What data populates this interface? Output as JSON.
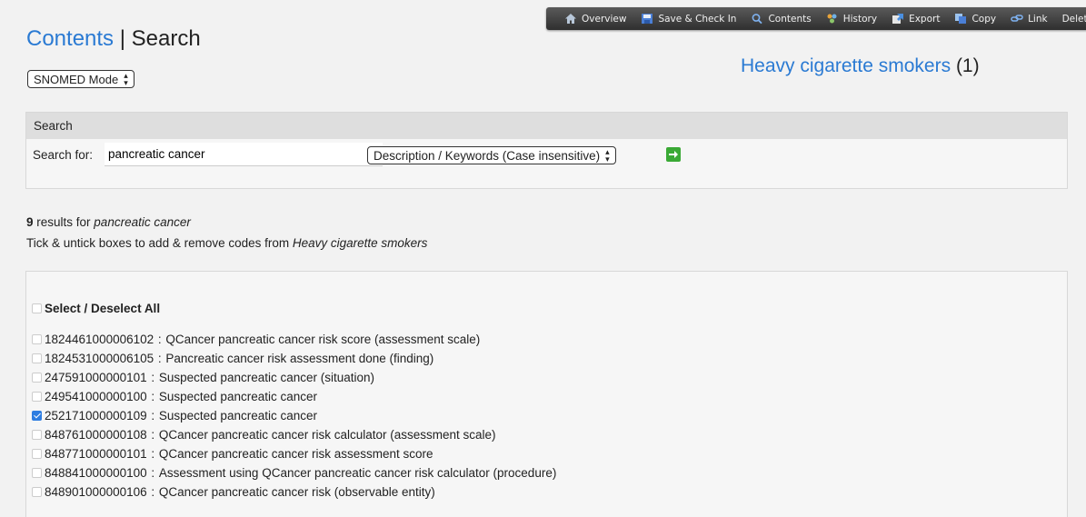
{
  "toolbar": {
    "items": [
      {
        "label": "Overview",
        "icon": "home-icon"
      },
      {
        "label": "Save & Check In",
        "icon": "save-icon"
      },
      {
        "label": "Contents",
        "icon": "search-icon"
      },
      {
        "label": "History",
        "icon": "history-icon"
      },
      {
        "label": "Export",
        "icon": "export-icon"
      },
      {
        "label": "Copy",
        "icon": "copy-icon"
      },
      {
        "label": "Link",
        "icon": "link-icon"
      },
      {
        "label": "Delete",
        "icon": "delete-icon"
      }
    ]
  },
  "header": {
    "contents_link": "Contents",
    "separator": "|",
    "search_title": "Search",
    "mode_select": "SNOMED Mode"
  },
  "list": {
    "name": "Heavy cigarette smokers",
    "count": "(1)"
  },
  "search": {
    "panel_title": "Search",
    "label": "Search for:",
    "query": "pancreatic cancer",
    "field_select": "Description / Keywords (Case insensitive)"
  },
  "results": {
    "count": "9",
    "summary_text": " results for ",
    "query": "pancreatic cancer",
    "instruction_text": "Tick & untick boxes to add & remove codes from ",
    "list_name": "Heavy cigarette smokers",
    "select_all_label": "Select / Deselect All",
    "items": [
      {
        "code": "1824461000006102",
        "description": "QCancer pancreatic cancer risk score (assessment scale)",
        "checked": false
      },
      {
        "code": "1824531000006105",
        "description": "Pancreatic cancer risk assessment done (finding)",
        "checked": false
      },
      {
        "code": "247591000000101",
        "description": "Suspected pancreatic cancer (situation)",
        "checked": false
      },
      {
        "code": "249541000000100",
        "description": "Suspected pancreatic cancer",
        "checked": false
      },
      {
        "code": "252171000000109",
        "description": "Suspected pancreatic cancer",
        "checked": true
      },
      {
        "code": "848761000000108",
        "description": "QCancer pancreatic cancer risk calculator (assessment scale)",
        "checked": false
      },
      {
        "code": "848771000000101",
        "description": "QCancer pancreatic cancer risk assessment score",
        "checked": false
      },
      {
        "code": "848841000000100",
        "description": "Assessment using QCancer pancreatic cancer risk calculator (procedure)",
        "checked": false
      },
      {
        "code": "848901000000106",
        "description": "QCancer pancreatic cancer risk (observable entity)",
        "checked": false
      }
    ]
  },
  "colors": {
    "link": "#2a7ad3",
    "toolbar_bg": "#3d3d3d",
    "checkbox_checked": "#2e7de1",
    "go_button": "#3aa935"
  }
}
